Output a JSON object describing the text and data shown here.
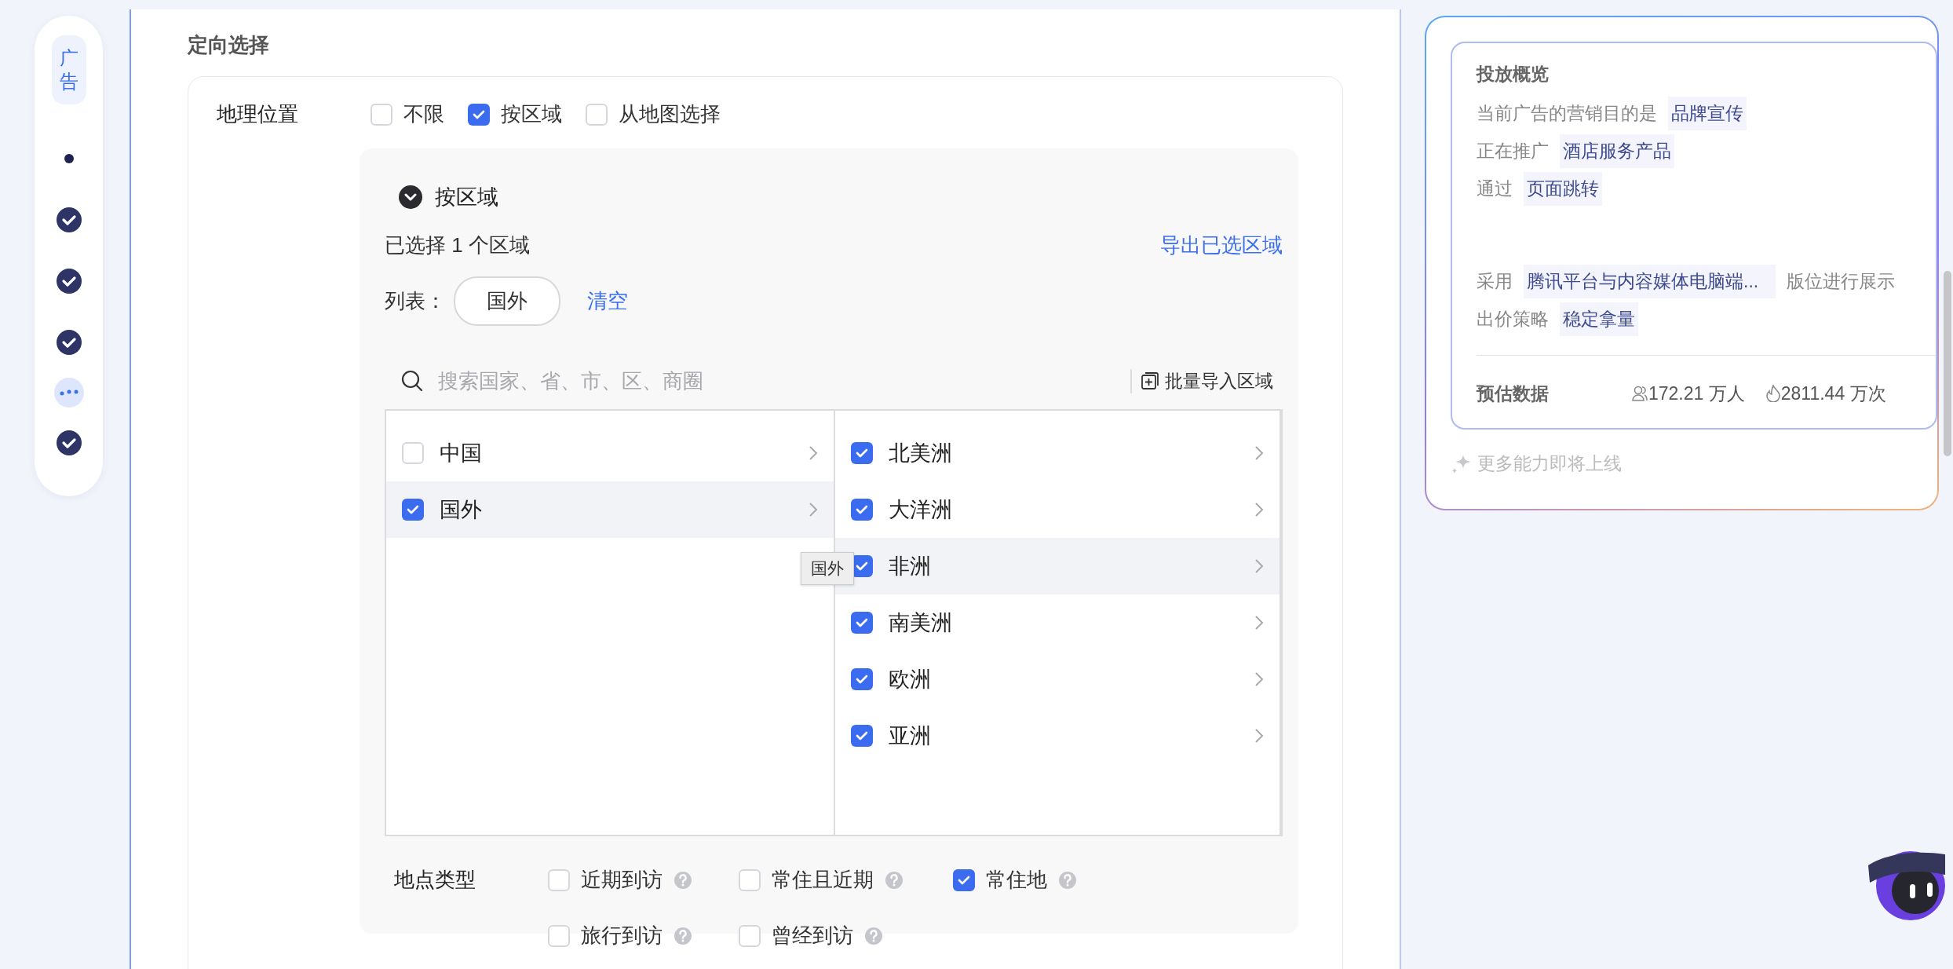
{
  "nav": {
    "items": [
      {
        "kind": "label",
        "label": "广告"
      },
      {
        "kind": "dot"
      },
      {
        "kind": "done"
      },
      {
        "kind": "done"
      },
      {
        "kind": "done"
      },
      {
        "kind": "more"
      },
      {
        "kind": "done"
      }
    ]
  },
  "section_title": "定向选择",
  "geo": {
    "label": "地理位置",
    "options": [
      {
        "label": "不限",
        "checked": false
      },
      {
        "label": "按区域",
        "checked": true
      },
      {
        "label": "从地图选择",
        "checked": false
      }
    ]
  },
  "region_panel": {
    "title": "按区域",
    "expanded": true,
    "summary": "已选择 1 个区域",
    "export_link": "导出已选区域",
    "list_label": "列表：",
    "chips": [
      "国外"
    ],
    "clear_link": "清空",
    "search": {
      "placeholder": "搜索国家、省、市、区、商圈"
    },
    "import_button": "批量导入区域",
    "left": [
      {
        "label": "中国",
        "checked": false,
        "selected": false
      },
      {
        "label": "国外",
        "checked": true,
        "selected": true
      }
    ],
    "right": [
      {
        "label": "北美洲",
        "checked": true,
        "highlighted": false
      },
      {
        "label": "大洋洲",
        "checked": true,
        "highlighted": false
      },
      {
        "label": "非洲",
        "checked": true,
        "highlighted": true
      },
      {
        "label": "南美洲",
        "checked": true,
        "highlighted": false
      },
      {
        "label": "欧洲",
        "checked": true,
        "highlighted": false
      },
      {
        "label": "亚洲",
        "checked": true,
        "highlighted": false
      }
    ],
    "tooltip": "国外"
  },
  "place_type": {
    "label": "地点类型",
    "options": [
      {
        "label": "近期到访",
        "checked": false
      },
      {
        "label": "常住且近期",
        "checked": false
      },
      {
        "label": "常住地",
        "checked": true
      },
      {
        "label": "旅行到访",
        "checked": false
      },
      {
        "label": "曾经到访",
        "checked": false
      }
    ]
  },
  "overview": {
    "title": "投放概览",
    "intro_lines": [
      {
        "prefix": "当前广告的营销目的是",
        "value": "品牌宣传"
      },
      {
        "prefix": "正在推广",
        "value": "酒店服务产品"
      },
      {
        "prefix": "通过",
        "value": "页面跳转"
      }
    ],
    "detail_lines": [
      {
        "prefix": "采用",
        "value": "腾讯平台与内容媒体电脑端...",
        "suffix": "版位进行展示"
      },
      {
        "prefix": "出价策略",
        "value": "稳定拿量"
      }
    ],
    "estimate": {
      "label": "预估数据",
      "reach": "172.21 万人",
      "impressions": "2811.44 万次"
    }
  },
  "footer_note": "更多能力即将上线"
}
